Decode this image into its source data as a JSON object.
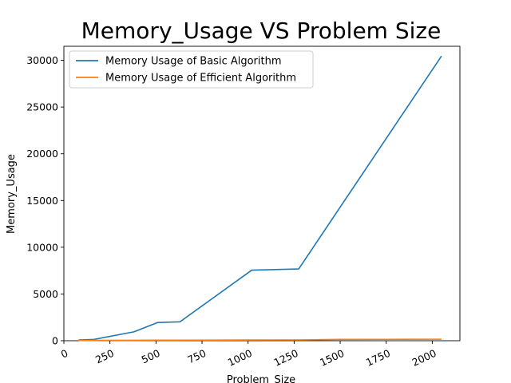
{
  "chart_data": {
    "type": "line",
    "title": "Memory_Usage VS Problem Size",
    "xlabel": "Problem_Size",
    "ylabel": "Memory_Usage",
    "xlim": [
      0,
      2150
    ],
    "ylim": [
      0,
      31500
    ],
    "xticks": [
      0,
      250,
      500,
      750,
      1000,
      1250,
      1500,
      1750,
      2000
    ],
    "yticks": [
      0,
      5000,
      10000,
      15000,
      20000,
      25000,
      30000
    ],
    "xtick_rotation_deg": 25,
    "grid": false,
    "legend_position": "upper-left",
    "series": [
      {
        "name": "Memory Usage of Basic Algorithm",
        "color": "#1f77b4",
        "x": [
          80,
          160,
          380,
          510,
          630,
          1020,
          1275,
          2050
        ],
        "y": [
          80,
          130,
          950,
          1950,
          2020,
          7550,
          7680,
          30450
        ]
      },
      {
        "name": "Memory Usage of Efficient Algorithm",
        "color": "#ff7f0e",
        "x": [
          80,
          160,
          380,
          510,
          630,
          1020,
          1275,
          1500,
          1750,
          2050
        ],
        "y": [
          40,
          40,
          50,
          55,
          55,
          80,
          85,
          140,
          150,
          160
        ]
      }
    ]
  }
}
